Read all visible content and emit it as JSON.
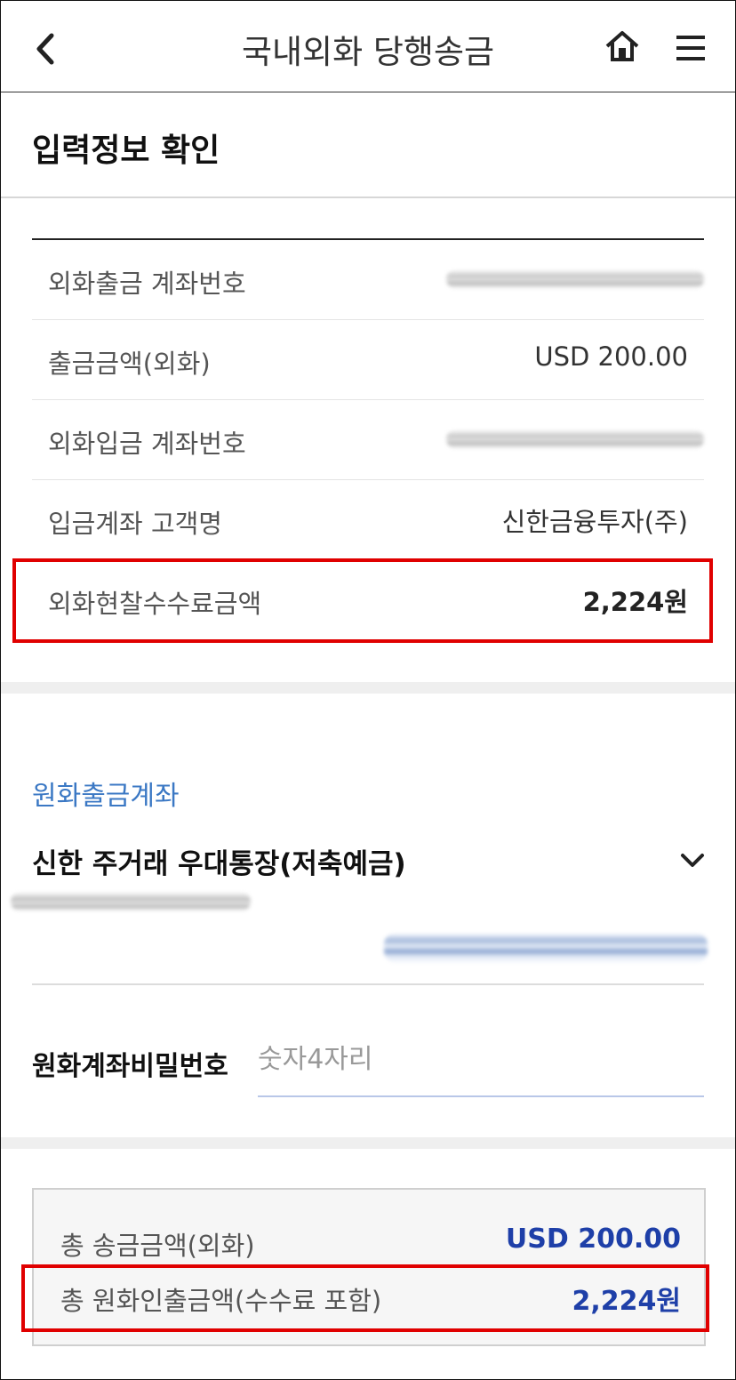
{
  "header": {
    "title": "국내외화 당행송금"
  },
  "section": {
    "title": "입력정보 확인"
  },
  "details": [
    {
      "label": "외화출금 계좌번호",
      "value": ""
    },
    {
      "label": "출금금액(외화)",
      "value": "USD 200.00"
    },
    {
      "label": "외화입금 계좌번호",
      "value": ""
    },
    {
      "label": "입금계좌 고객명",
      "value": "신한금융투자(주)"
    },
    {
      "label": "외화현찰수수료금액",
      "value": "2,224원"
    }
  ],
  "won_account": {
    "label": "원화출금계좌",
    "account_name": "신한 주거래 우대통장(저축예금)"
  },
  "password": {
    "label": "원화계좌비밀번호",
    "placeholder": "숫자4자리"
  },
  "summary": {
    "total_fx_label": "총 송금금액(외화)",
    "total_fx_value": "USD 200.00",
    "total_krw_label": "총 원화인출금액(수수료 포함)",
    "total_krw_value": "2,224원"
  },
  "colors": {
    "highlight_box": "#e00000",
    "accent_blue": "#1e3fa8",
    "label_blue": "#3b78c4"
  },
  "icons": [
    "back-arrow-icon",
    "home-icon",
    "hamburger-menu-icon",
    "chevron-down-icon"
  ]
}
